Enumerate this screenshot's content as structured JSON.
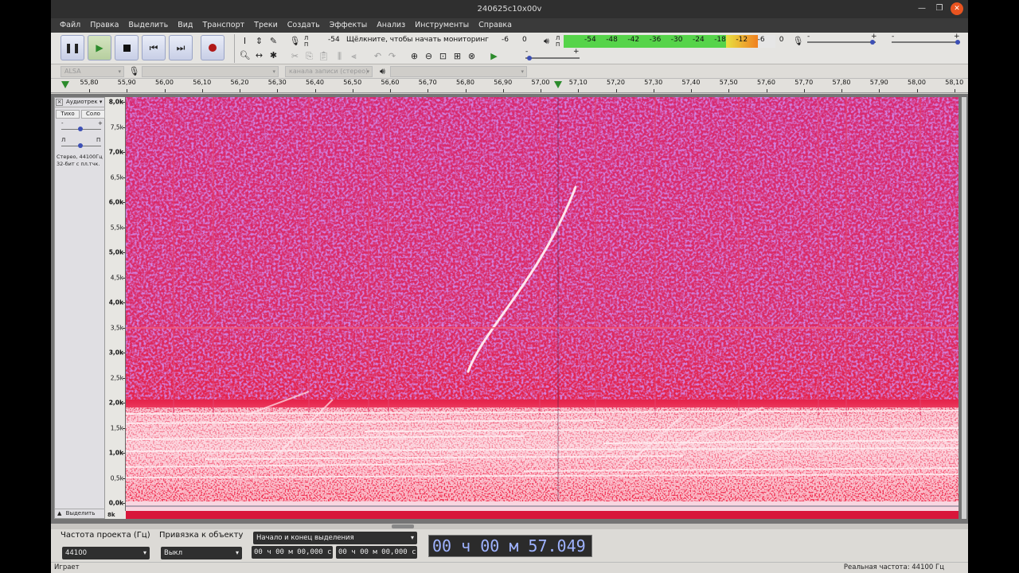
{
  "window": {
    "title": "240625c10x00v"
  },
  "menu": [
    "Файл",
    "Правка",
    "Выделить",
    "Вид",
    "Транспорт",
    "Треки",
    "Создать",
    "Эффекты",
    "Анализ",
    "Инструменты",
    "Справка"
  ],
  "recording_meter": {
    "l": "Л",
    "p": "П",
    "left_value": "-54",
    "hint": "Щёлкните, чтобы начать мониторинг",
    "right_value": "-6",
    "end_value": "0"
  },
  "playback_meter": {
    "l": "Л",
    "p": "П",
    "scale": [
      "-54",
      "-48",
      "-42",
      "-36",
      "-30",
      "-24",
      "-18",
      "-12",
      "-6",
      "0"
    ]
  },
  "mixer": {
    "minus": "-",
    "plus": "+"
  },
  "device": {
    "host": "ALSA",
    "channels": "канала записи (стерео)",
    "arrow": "▾"
  },
  "ruler": {
    "ticks": [
      "55,80",
      "55,90",
      "56,00",
      "56,10",
      "56,20",
      "56,30",
      "56,40",
      "56,50",
      "56,60",
      "56,70",
      "56,80",
      "56,90",
      "57,00",
      "57,10",
      "57,20",
      "57,30",
      "57,40",
      "57,50",
      "57,60",
      "57,70",
      "57,80",
      "57,90",
      "58,00",
      "58,10"
    ]
  },
  "track": {
    "close": "×",
    "name": "Аудиотрек",
    "name_arrow": "▾",
    "mute": "Тихо",
    "solo": "Соло",
    "gain_minus": "-",
    "gain_plus": "+",
    "pan_left": "Л",
    "pan_right": "П",
    "info_line1": "Стерео, 44100Гц",
    "info_line2": "32-бит с пл.тчк.",
    "collapse": "▲",
    "select": "Выделить",
    "freq_labels": [
      "8,0k",
      "7,5k",
      "7,0k",
      "6,5k",
      "6,0k",
      "5,5k",
      "5,0k",
      "4,5k",
      "4,0k",
      "3,5k",
      "3,0k",
      "2,5k",
      "2,0k",
      "1,5k",
      "1,0k",
      "0,5k",
      "0,0k"
    ],
    "second_channel_top": "8k"
  },
  "selection_toolbar": {
    "rate_label": "Частота проекта (Гц)",
    "rate_value": "44100",
    "snap_label": "Привязка к объекту",
    "snap_value": "Выкл",
    "sel_mode": "Начало и конец выделения",
    "sel_start": "00 ч 00 м 00,000 с",
    "sel_end": "00 ч 00 м 00,000 с",
    "position": "00 ч 00 м 57.049 с"
  },
  "status": {
    "state": "Играет",
    "actual_rate": "Реальная частота: 44100 Гц"
  },
  "colors": {
    "spectrogram_base": "#de2b6c",
    "spectrogram_high": "#a53ad8",
    "spectrogram_hot": "#ffffff",
    "meter_green": "#56d44a",
    "meter_red": "#e82020"
  }
}
